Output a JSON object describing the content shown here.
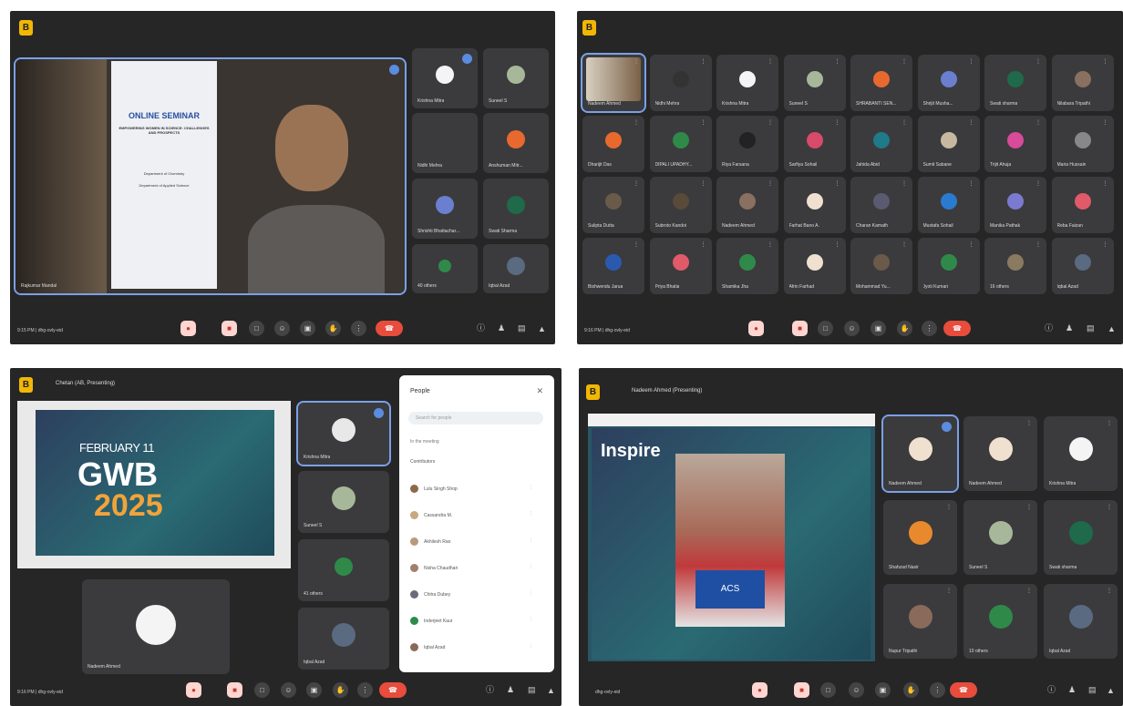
{
  "app_logo": "B",
  "colors": {
    "meet_bg": "#262626",
    "tile_bg": "#3b3b3d",
    "accent": "#7aa0e8",
    "end_call": "#e74c3c"
  },
  "panel1": {
    "main_speaker": "Rajkumar Mandal",
    "poster": {
      "title": "ONLINE SEMINAR",
      "topic": "EMPOWERING WOMEN IN SCIENCE: CHALLENGES AND PROSPECTS",
      "dept1": "Department of Chemistry",
      "dept2": "Department of Applied Science"
    },
    "tiles": [
      "Krishna Mitra",
      "Suneel S",
      "Nidhi Mehra",
      "Anshuman Mitr...",
      "Shrishti Bhattachar...",
      "Swati Sharma",
      "40 others",
      "Iqbal Azad"
    ],
    "time": "9:15 PM | dhg-ovly-eid"
  },
  "panel2": {
    "tiles": [
      "Nadeem Ahmed",
      "Nidhi Mehra",
      "Krishna Mitra",
      "Suneel S",
      "SHRABANTI SEN...",
      "Shrijit Musha...",
      "Swati sharma",
      "Nilabara Tripathi",
      "Dharijit Das",
      "DIPALI UPADHY...",
      "Riya Farsana",
      "Sarfiya Sohail",
      "Jahida Abid",
      "Sumit Sabane",
      "Trijit Ahuja",
      "Maria Hussain",
      "Sulipta Dutta",
      "Subroto Kandoi",
      "Nadeem Ahmed",
      "Farhat Bano A.",
      "Charan Kamath",
      "Mustafa Sohail",
      "Manika Pathak",
      "Reba Faizan",
      "Bishwendu Jarua",
      "Priya Bhatia",
      "Shamika Jha",
      "Afrin Farhad",
      "Mohammad Yu...",
      "Jyoti Kumari",
      "16 others",
      "Iqbal Azad"
    ],
    "time": "9:16 PM | dhg-ovly-eid"
  },
  "panel3": {
    "presenter_label": "Chetan (AB, Presenting)",
    "slide": {
      "date": "FEBRUARY 11",
      "title": "GWB",
      "year": "2025"
    },
    "self_name": "Nadeem Ahmed",
    "tiles": [
      "Krishna Mitra",
      "Suneel S",
      "41 others",
      "Iqbal Azad"
    ],
    "people_panel": {
      "title": "People",
      "search": "Search for people",
      "section": "In the meeting",
      "contributors": "Contributors",
      "rows": [
        "Lulu Singh Shop",
        "Cassandra M.",
        "Akhilesh Rao",
        "Nisha Chaudhari",
        "Chitra Dubey",
        "Inderjeet Kaur",
        "Iqbal Azad"
      ]
    },
    "time": "9:16 PM | dhg-ovly-eid"
  },
  "panel4": {
    "presenter_label": "Nadeem Ahmed (Presenting)",
    "slide_title": "Inspire",
    "banner": "ACS",
    "tiles": [
      "Nadeem Ahmed",
      "Nadeem Ahmed",
      "Krishna Mitra",
      "Shahzad Nasir",
      "Suneel S",
      "Swati sharma",
      "Nupur Tripathi",
      "10 others",
      "Iqbal Azad"
    ],
    "time": "dhg-ovly-eid"
  },
  "controls": {
    "end_icon": "phone-end-icon",
    "mic": "mic-off-icon",
    "cam": "camera-off-icon"
  }
}
